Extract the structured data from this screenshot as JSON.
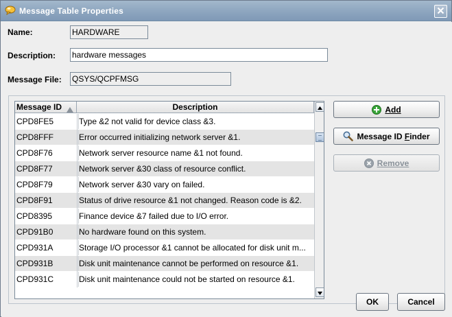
{
  "window": {
    "title": "Message Table Properties",
    "app_icon": "speech-bubble-icon",
    "close_icon": "close-icon"
  },
  "form": {
    "name_label": "Name:",
    "name_value": "HARDWARE",
    "description_label": "Description:",
    "description_value": "hardware messages",
    "message_file_label": "Message File:",
    "message_file_value": "QSYS/QCPFMSG"
  },
  "table": {
    "columns": [
      "Message ID",
      "Description"
    ],
    "sort_column": "Message ID",
    "sort_direction": "ascending",
    "rows": [
      {
        "id": "CPD8FE5",
        "description": "Type &2 not valid for device class &3."
      },
      {
        "id": "CPD8FFF",
        "description": "Error occurred initializing network server &1."
      },
      {
        "id": "CPD8F76",
        "description": "Network server resource name &1 not found."
      },
      {
        "id": "CPD8F77",
        "description": "Network server &30 class of resource conflict."
      },
      {
        "id": "CPD8F79",
        "description": "Network server &30 vary on failed."
      },
      {
        "id": "CPD8F91",
        "description": "Status of drive resource &1 not changed.  Reason code is &2."
      },
      {
        "id": "CPD8395",
        "description": "Finance device &7 failed due to I/O error."
      },
      {
        "id": "CPD91B0",
        "description": "No hardware found on this system."
      },
      {
        "id": "CPD931A",
        "description": "Storage I/O processor &1 cannot be allocated for disk unit m..."
      },
      {
        "id": "CPD931B",
        "description": "Disk unit maintenance cannot be performed on resource &1."
      },
      {
        "id": "CPD931C",
        "description": "Disk unit maintenance could not be started on resource &1."
      }
    ]
  },
  "buttons": {
    "add": "Add",
    "finder_prefix": "Message ID ",
    "finder_mnemonic": "F",
    "finder_suffix": "inder",
    "remove": "Remove",
    "ok": "OK",
    "cancel": "Cancel"
  },
  "colors": {
    "titlebar": "#8fa7c0",
    "row_alt": "#e4e4e4",
    "add_icon": "#3aa63a",
    "remove_icon_disabled": "#9aa2aa"
  }
}
